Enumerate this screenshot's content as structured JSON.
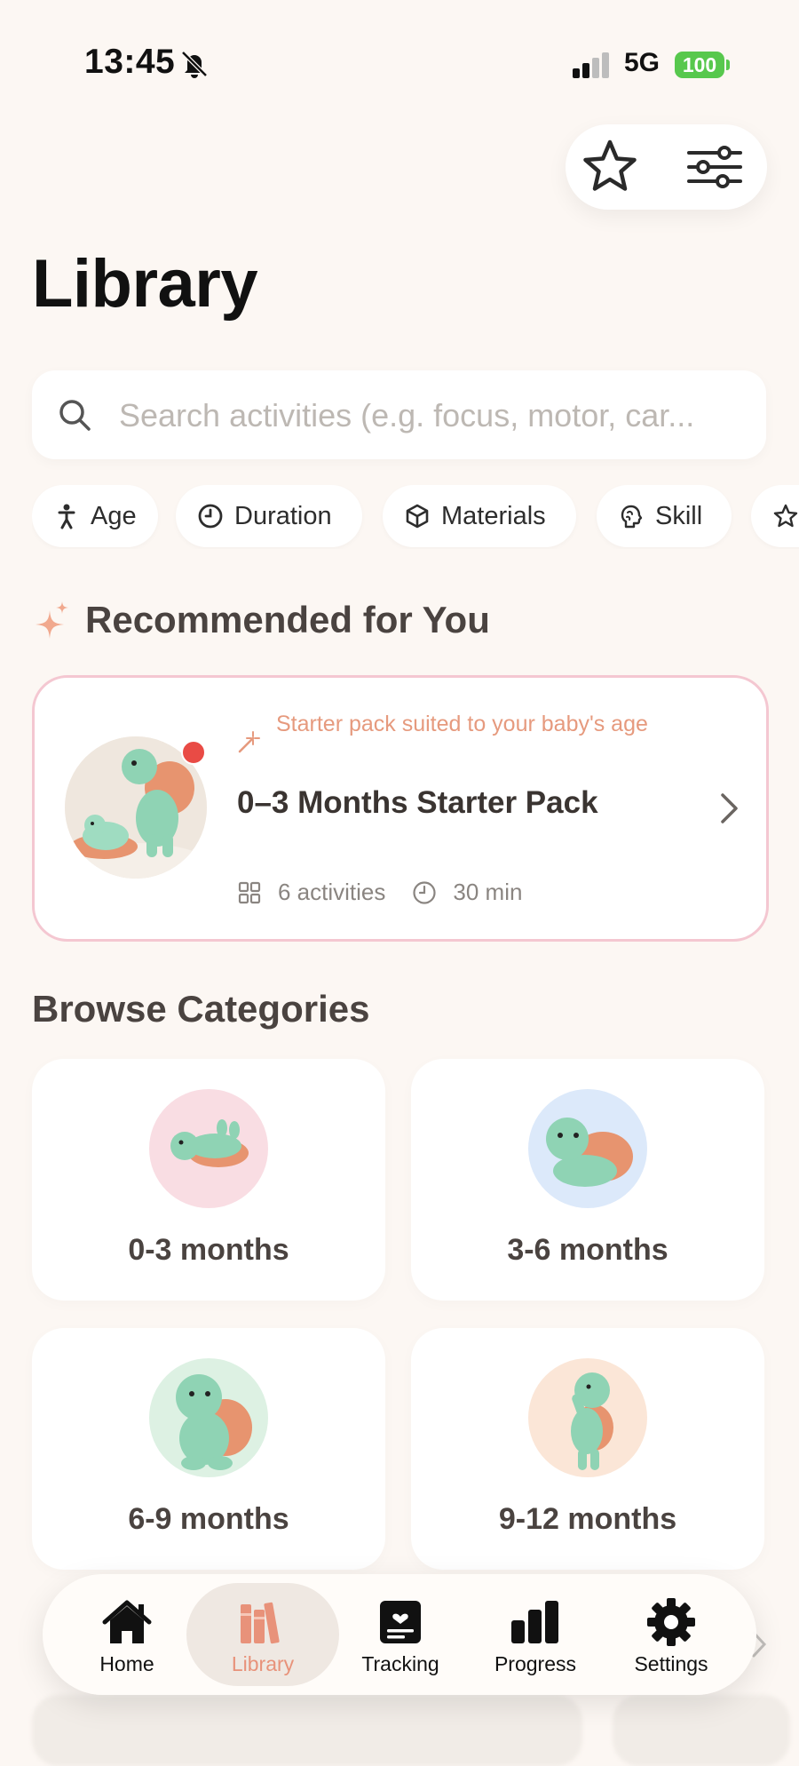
{
  "status_bar": {
    "time": "13:45",
    "network": "5G",
    "battery": "100"
  },
  "page": {
    "title": "Library"
  },
  "search": {
    "placeholder": "Search activities (e.g. focus, motor, car..."
  },
  "filters": [
    {
      "label": "Age",
      "icon": "person-icon"
    },
    {
      "label": "Duration",
      "icon": "clock-icon"
    },
    {
      "label": "Materials",
      "icon": "cube-icon"
    },
    {
      "label": "Skill",
      "icon": "brain-icon"
    }
  ],
  "recommended": {
    "section_title": "Recommended for You",
    "card": {
      "kicker": "Starter pack suited to your baby's age",
      "title": "0–3 Months Starter Pack",
      "activities": "6 activities",
      "duration": "30 min"
    }
  },
  "categories": {
    "section_title": "Browse Categories",
    "items": [
      {
        "label": "0-3 months",
        "color": "#F9DDE3"
      },
      {
        "label": "3-6 months",
        "color": "#DCE9FA"
      },
      {
        "label": "6-9 months",
        "color": "#DDF1E3"
      },
      {
        "label": "9-12 months",
        "color": "#FBE6D7"
      }
    ]
  },
  "bottom_nav": {
    "items": [
      {
        "label": "Home",
        "icon": "house-icon"
      },
      {
        "label": "Library",
        "icon": "books-icon",
        "active": true
      },
      {
        "label": "Tracking",
        "icon": "tracking-card-icon"
      },
      {
        "label": "Progress",
        "icon": "bar-chart-icon"
      },
      {
        "label": "Settings",
        "icon": "gear-icon"
      }
    ]
  },
  "colors": {
    "accent": "#E8927A",
    "background": "#FCF7F3",
    "alert_dot": "#E94B45",
    "battery": "#57C84D"
  }
}
